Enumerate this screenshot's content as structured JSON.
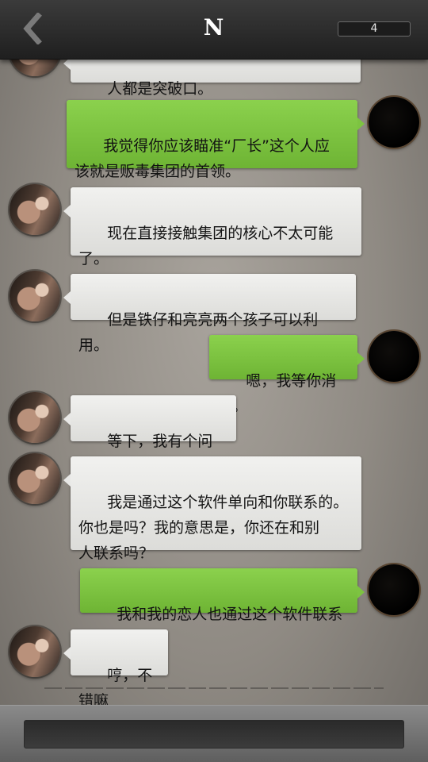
{
  "header": {
    "title": "N",
    "counter": "4"
  },
  "messages": [
    {
      "side": "npc",
      "text": "人都是突破口。"
    },
    {
      "side": "me",
      "text": "我觉得你应该瞄准“厂长”这个人应\n该就是贩毒集团的首领。"
    },
    {
      "side": "npc",
      "text": "现在直接接触集团的核心不太可能\n了。"
    },
    {
      "side": "npc",
      "text": "但是铁仔和亮亮两个孩子可以利用。"
    },
    {
      "side": "me",
      "text": "嗯，我等你消息。"
    },
    {
      "side": "npc",
      "text": "等下，我有个问题。"
    },
    {
      "side": "npc",
      "text": "我是通过这个软件单向和你联系的。\n你也是吗？我的意思是，你还在和别\n人联系吗？"
    },
    {
      "side": "me",
      "text": "我和我的恋人也通过这个软件联系~"
    },
    {
      "side": "npc",
      "text": "哼，不错嘛"
    }
  ],
  "icons": {
    "back": "chevron-left-icon"
  },
  "colors": {
    "topbar": "#2b2b2b",
    "my_bubble": "#7dc341",
    "npc_bubble": "#e8e8e6"
  }
}
